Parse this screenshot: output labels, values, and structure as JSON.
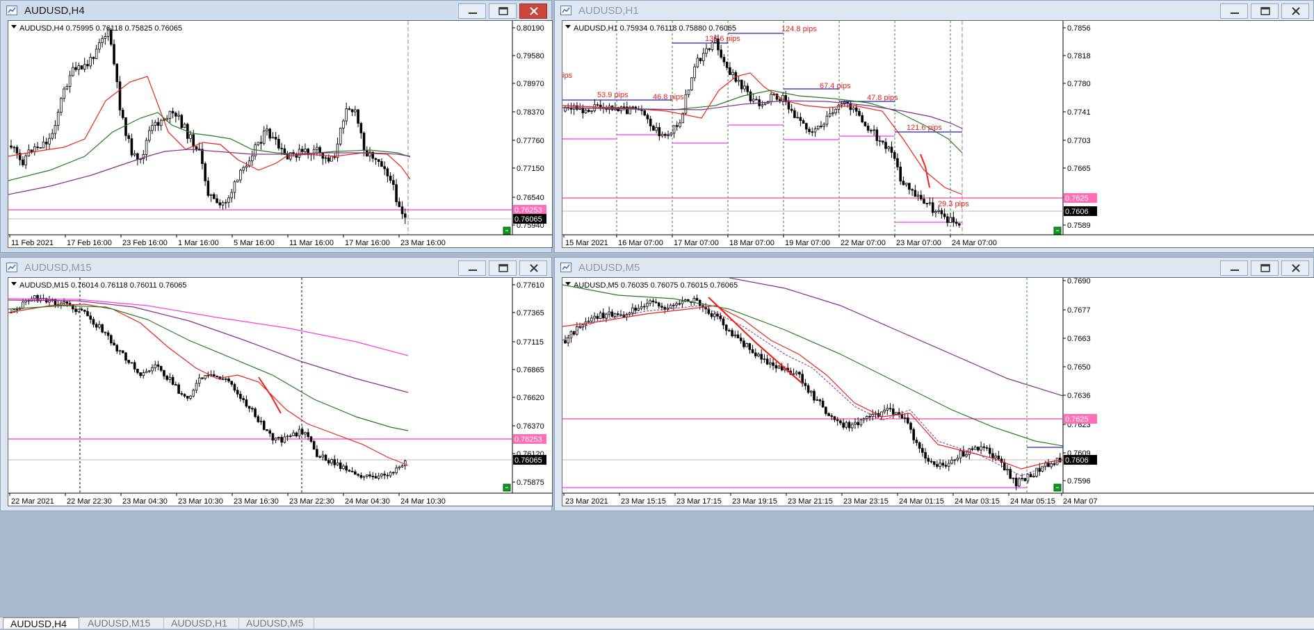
{
  "windows": [
    {
      "title": "AUDUSD,H4",
      "state": "active",
      "header": "AUDUSD,H4  0.75995 0.76118 0.75825 0.76065",
      "price_labels": [
        "0.80190",
        "0.79580",
        "0.78970",
        "0.78370",
        "0.77760",
        "0.77150",
        "0.76540",
        "0.75940"
      ],
      "time_labels": [
        "11 Feb 2021",
        "17 Feb 16:00",
        "23 Feb 16:00",
        "1 Mar 16:00",
        "5 Mar 16:00",
        "11 Mar 16:00",
        "17 Mar 16:00",
        "23 Mar 16:00"
      ],
      "level_tag": "0.76253",
      "current_tag": "0.76065"
    },
    {
      "title": "AUDUSD,H1",
      "state": "inactive",
      "header": "AUDUSD,H1  0.75934 0.76118 0.75880 0.76065",
      "price_labels": [
        "0.7856",
        "0.7818",
        "0.7780",
        "0.7741",
        "0.7703",
        "0.7665",
        "0.7625",
        "0.7589"
      ],
      "time_labels": [
        "15 Mar 2021",
        "16 Mar 07:00",
        "17 Mar 07:00",
        "18 Mar 07:00",
        "19 Mar 07:00",
        "22 Mar 07:00",
        "23 Mar 07:00",
        "24 Mar 07:00"
      ],
      "level_tag": "0.7625",
      "current_tag": "0.7606",
      "pips_labels": [
        "ips",
        "53.9 pips",
        "46.8 pips",
        "136.6 pips",
        "124.8 pips",
        "67.4 pips",
        "47.8 pips",
        "121.6 pips",
        "29.3 pips"
      ]
    },
    {
      "title": "AUDUSD,M15",
      "state": "inactive",
      "header": "AUDUSD,M15  0.76014 0.76118 0.76011 0.76065",
      "price_labels": [
        "0.77610",
        "0.77365",
        "0.77115",
        "0.76865",
        "0.76620",
        "0.76370",
        "0.76120",
        "0.75875"
      ],
      "time_labels": [
        "22 Mar 2021",
        "22 Mar 22:30",
        "23 Mar 04:30",
        "23 Mar 10:30",
        "23 Mar 16:30",
        "23 Mar 22:30",
        "24 Mar 04:30",
        "24 Mar 10:30"
      ],
      "level_tag": "0.76253",
      "current_tag": "0.76065"
    },
    {
      "title": "AUDUSD,M5",
      "state": "inactive",
      "header": "AUDUSD,M5  0.76035 0.76075 0.76015 0.76065",
      "price_labels": [
        "0.7690",
        "0.7677",
        "0.7663",
        "0.7650",
        "0.7636",
        "0.7623",
        "0.7609",
        "0.7596"
      ],
      "time_labels": [
        "23 Mar 2021",
        "23 Mar 15:15",
        "23 Mar 17:15",
        "23 Mar 19:15",
        "23 Mar 21:15",
        "23 Mar 23:15",
        "24 Mar 01:15",
        "24 Mar 03:15",
        "24 Mar 05:15",
        "24 Mar 07"
      ],
      "level_tag": "0.7625",
      "current_tag": "0.7606"
    }
  ],
  "tabs": [
    "AUDUSD,H4",
    "AUDUSD,M15",
    "AUDUSD,H1",
    "AUDUSD,M5"
  ],
  "colors": {
    "bull_candle": "#ffffff",
    "bear_candle": "#000000",
    "ma_fast": "#e8231c",
    "ma_mid": "#237a1f",
    "ma_slow": "#8a2b8a",
    "ma_m15_top": "#ff39e0",
    "level_line": "#ff3fa8",
    "level_tag_bg": "#ff6fb5",
    "current_line": "#b9b9b9",
    "zone_top": "#1f1fd0",
    "zone_bottom": "#ff33ff",
    "session_separator": "#2c8a2c",
    "pips_text": "#e02020"
  }
}
